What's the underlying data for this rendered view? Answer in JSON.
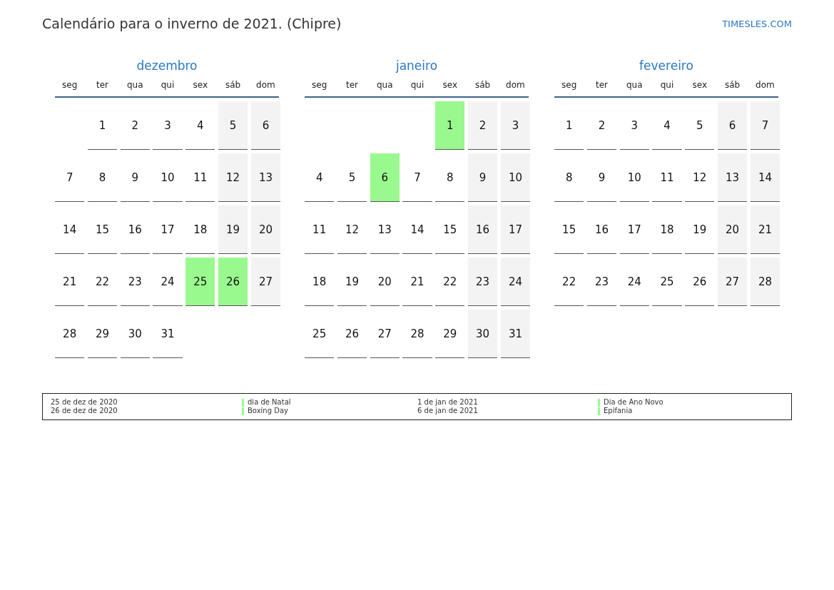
{
  "title": "Calendário para o inverno de 2021. (Chipre)",
  "site": "TIMESLES.COM",
  "months": [
    {
      "name": "dezembro",
      "weekdays": [
        "seg",
        "ter",
        "qua",
        "qui",
        "sex",
        "sáb",
        "dom"
      ],
      "weeks": [
        [
          {
            "kind": "blank"
          },
          {
            "d": "1",
            "kind": "weekday"
          },
          {
            "d": "2",
            "kind": "weekday"
          },
          {
            "d": "3",
            "kind": "weekday"
          },
          {
            "d": "4",
            "kind": "weekday"
          },
          {
            "d": "5",
            "kind": "weekend"
          },
          {
            "d": "6",
            "kind": "weekend"
          }
        ],
        [
          {
            "d": "7",
            "kind": "weekday"
          },
          {
            "d": "8",
            "kind": "weekday"
          },
          {
            "d": "9",
            "kind": "weekday"
          },
          {
            "d": "10",
            "kind": "weekday"
          },
          {
            "d": "11",
            "kind": "weekday"
          },
          {
            "d": "12",
            "kind": "weekend"
          },
          {
            "d": "13",
            "kind": "weekend"
          }
        ],
        [
          {
            "d": "14",
            "kind": "weekday"
          },
          {
            "d": "15",
            "kind": "weekday"
          },
          {
            "d": "16",
            "kind": "weekday"
          },
          {
            "d": "17",
            "kind": "weekday"
          },
          {
            "d": "18",
            "kind": "weekday"
          },
          {
            "d": "19",
            "kind": "weekend"
          },
          {
            "d": "20",
            "kind": "weekend"
          }
        ],
        [
          {
            "d": "21",
            "kind": "weekday"
          },
          {
            "d": "22",
            "kind": "weekday"
          },
          {
            "d": "23",
            "kind": "weekday"
          },
          {
            "d": "24",
            "kind": "weekday"
          },
          {
            "d": "25",
            "kind": "holiday"
          },
          {
            "d": "26",
            "kind": "holiday"
          },
          {
            "d": "27",
            "kind": "weekend"
          }
        ],
        [
          {
            "d": "28",
            "kind": "weekday"
          },
          {
            "d": "29",
            "kind": "weekday"
          },
          {
            "d": "30",
            "kind": "weekday"
          },
          {
            "d": "31",
            "kind": "weekday"
          },
          {
            "kind": "blank"
          },
          {
            "kind": "blank"
          },
          {
            "kind": "blank"
          }
        ]
      ]
    },
    {
      "name": "janeiro",
      "weekdays": [
        "seg",
        "ter",
        "qua",
        "qui",
        "sex",
        "sáb",
        "dom"
      ],
      "weeks": [
        [
          {
            "kind": "blank"
          },
          {
            "kind": "blank"
          },
          {
            "kind": "blank"
          },
          {
            "kind": "blank"
          },
          {
            "d": "1",
            "kind": "holiday"
          },
          {
            "d": "2",
            "kind": "weekend"
          },
          {
            "d": "3",
            "kind": "weekend"
          }
        ],
        [
          {
            "d": "4",
            "kind": "weekday"
          },
          {
            "d": "5",
            "kind": "weekday"
          },
          {
            "d": "6",
            "kind": "holiday"
          },
          {
            "d": "7",
            "kind": "weekday"
          },
          {
            "d": "8",
            "kind": "weekday"
          },
          {
            "d": "9",
            "kind": "weekend"
          },
          {
            "d": "10",
            "kind": "weekend"
          }
        ],
        [
          {
            "d": "11",
            "kind": "weekday"
          },
          {
            "d": "12",
            "kind": "weekday"
          },
          {
            "d": "13",
            "kind": "weekday"
          },
          {
            "d": "14",
            "kind": "weekday"
          },
          {
            "d": "15",
            "kind": "weekday"
          },
          {
            "d": "16",
            "kind": "weekend"
          },
          {
            "d": "17",
            "kind": "weekend"
          }
        ],
        [
          {
            "d": "18",
            "kind": "weekday"
          },
          {
            "d": "19",
            "kind": "weekday"
          },
          {
            "d": "20",
            "kind": "weekday"
          },
          {
            "d": "21",
            "kind": "weekday"
          },
          {
            "d": "22",
            "kind": "weekday"
          },
          {
            "d": "23",
            "kind": "weekend"
          },
          {
            "d": "24",
            "kind": "weekend"
          }
        ],
        [
          {
            "d": "25",
            "kind": "weekday"
          },
          {
            "d": "26",
            "kind": "weekday"
          },
          {
            "d": "27",
            "kind": "weekday"
          },
          {
            "d": "28",
            "kind": "weekday"
          },
          {
            "d": "29",
            "kind": "weekday"
          },
          {
            "d": "30",
            "kind": "weekend"
          },
          {
            "d": "31",
            "kind": "weekend"
          }
        ]
      ]
    },
    {
      "name": "fevereiro",
      "weekdays": [
        "seg",
        "ter",
        "qua",
        "qui",
        "sex",
        "sáb",
        "dom"
      ],
      "weeks": [
        [
          {
            "d": "1",
            "kind": "weekday"
          },
          {
            "d": "2",
            "kind": "weekday"
          },
          {
            "d": "3",
            "kind": "weekday"
          },
          {
            "d": "4",
            "kind": "weekday"
          },
          {
            "d": "5",
            "kind": "weekday"
          },
          {
            "d": "6",
            "kind": "weekend"
          },
          {
            "d": "7",
            "kind": "weekend"
          }
        ],
        [
          {
            "d": "8",
            "kind": "weekday"
          },
          {
            "d": "9",
            "kind": "weekday"
          },
          {
            "d": "10",
            "kind": "weekday"
          },
          {
            "d": "11",
            "kind": "weekday"
          },
          {
            "d": "12",
            "kind": "weekday"
          },
          {
            "d": "13",
            "kind": "weekend"
          },
          {
            "d": "14",
            "kind": "weekend"
          }
        ],
        [
          {
            "d": "15",
            "kind": "weekday"
          },
          {
            "d": "16",
            "kind": "weekday"
          },
          {
            "d": "17",
            "kind": "weekday"
          },
          {
            "d": "18",
            "kind": "weekday"
          },
          {
            "d": "19",
            "kind": "weekday"
          },
          {
            "d": "20",
            "kind": "weekend"
          },
          {
            "d": "21",
            "kind": "weekend"
          }
        ],
        [
          {
            "d": "22",
            "kind": "weekday"
          },
          {
            "d": "23",
            "kind": "weekday"
          },
          {
            "d": "24",
            "kind": "weekday"
          },
          {
            "d": "25",
            "kind": "weekday"
          },
          {
            "d": "26",
            "kind": "weekday"
          },
          {
            "d": "27",
            "kind": "weekend"
          },
          {
            "d": "28",
            "kind": "weekend"
          }
        ]
      ]
    }
  ],
  "holidays": [
    {
      "date": "25 de dez de 2020",
      "name": "dia de Natal"
    },
    {
      "date": "26 de dez de 2020",
      "name": "Boxing Day"
    },
    {
      "date": "1 de jan de 2021",
      "name": "Dia de Ano Novo"
    },
    {
      "date": "6 de jan de 2021",
      "name": "Epifania"
    }
  ]
}
